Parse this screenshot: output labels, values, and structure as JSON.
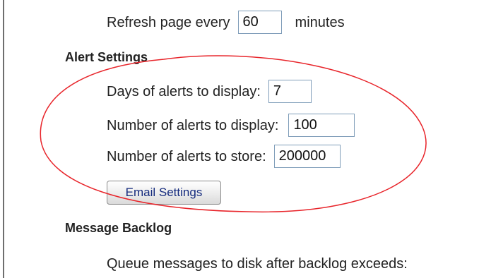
{
  "general": {
    "refresh_prefix": "Refresh page every",
    "refresh_value": "60",
    "refresh_suffix": "minutes"
  },
  "alert_settings": {
    "heading": "Alert Settings",
    "days_label": "Days of alerts to display:",
    "days_value": "7",
    "display_label": "Number of alerts to display:",
    "display_value": "100",
    "store_label": "Number of alerts to store:",
    "store_value": "200000",
    "email_button_label": "Email Settings"
  },
  "message_backlog": {
    "heading": "Message Backlog",
    "queue_label": "Queue messages to disk after backlog exceeds:"
  },
  "colors": {
    "annotation_ellipse": "#e8242a",
    "input_border": "#7f9db9",
    "button_text": "#142a7d"
  }
}
